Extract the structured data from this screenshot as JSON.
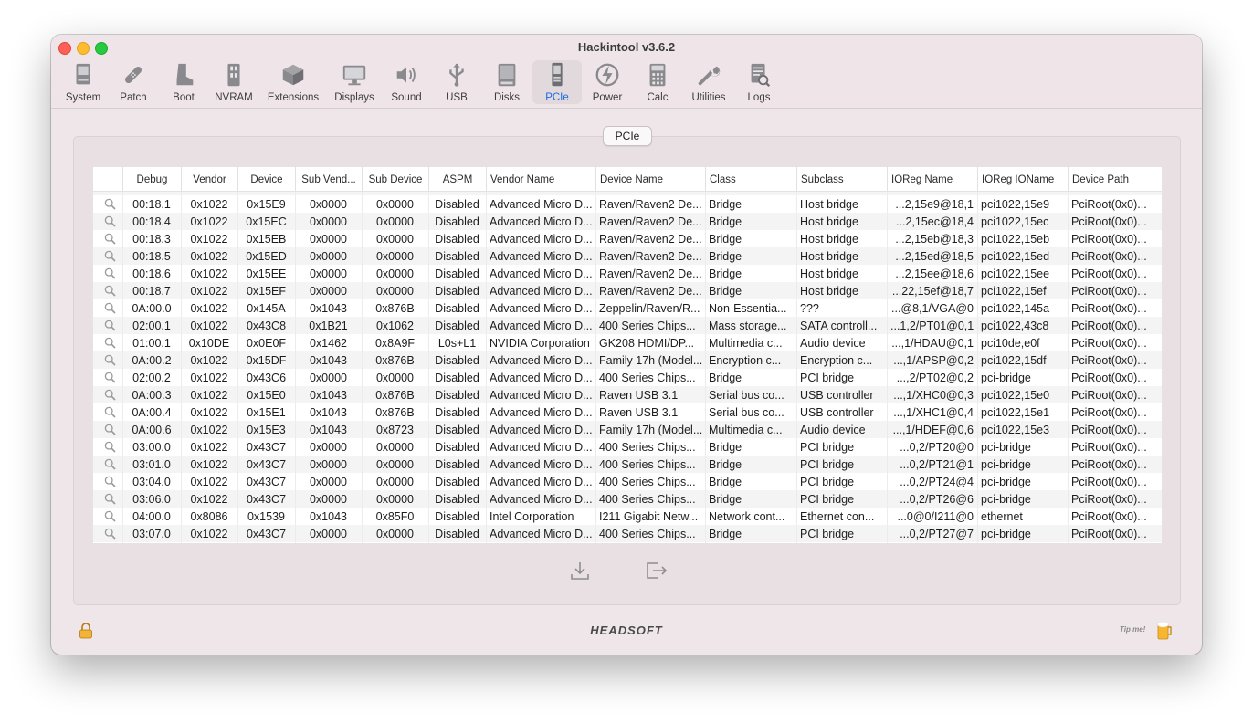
{
  "window": {
    "title": "Hackintool v3.6.2"
  },
  "toolbar": [
    {
      "label": "System",
      "icon": "system-icon"
    },
    {
      "label": "Patch",
      "icon": "patch-icon"
    },
    {
      "label": "Boot",
      "icon": "boot-icon"
    },
    {
      "label": "NVRAM",
      "icon": "nvram-icon"
    },
    {
      "label": "Extensions",
      "icon": "extensions-icon"
    },
    {
      "label": "Displays",
      "icon": "displays-icon"
    },
    {
      "label": "Sound",
      "icon": "sound-icon"
    },
    {
      "label": "USB",
      "icon": "usb-icon"
    },
    {
      "label": "Disks",
      "icon": "disks-icon"
    },
    {
      "label": "PCIe",
      "icon": "pcie-icon",
      "active": true
    },
    {
      "label": "Power",
      "icon": "power-icon"
    },
    {
      "label": "Calc",
      "icon": "calc-icon"
    },
    {
      "label": "Utilities",
      "icon": "utilities-icon"
    },
    {
      "label": "Logs",
      "icon": "logs-icon"
    }
  ],
  "segment": {
    "label": "PCIe"
  },
  "table": {
    "columns": [
      "",
      "Debug",
      "Vendor",
      "Device",
      "Sub Vend...",
      "Sub Device",
      "ASPM",
      "Vendor Name",
      "Device Name",
      "Class",
      "Subclass",
      "IOReg Name",
      "IOReg IOName",
      "Device Path"
    ],
    "partial_row_top": {
      "subclass": "Host bridge"
    },
    "rows": [
      [
        "00:18.1",
        "0x1022",
        "0x15E9",
        "0x0000",
        "0x0000",
        "Disabled",
        "Advanced Micro D...",
        "Raven/Raven2 De...",
        "Bridge",
        "Host bridge",
        "...2,15e9@18,1",
        "pci1022,15e9",
        "PciRoot(0x0)..."
      ],
      [
        "00:18.4",
        "0x1022",
        "0x15EC",
        "0x0000",
        "0x0000",
        "Disabled",
        "Advanced Micro D...",
        "Raven/Raven2 De...",
        "Bridge",
        "Host bridge",
        "...2,15ec@18,4",
        "pci1022,15ec",
        "PciRoot(0x0)..."
      ],
      [
        "00:18.3",
        "0x1022",
        "0x15EB",
        "0x0000",
        "0x0000",
        "Disabled",
        "Advanced Micro D...",
        "Raven/Raven2 De...",
        "Bridge",
        "Host bridge",
        "...2,15eb@18,3",
        "pci1022,15eb",
        "PciRoot(0x0)..."
      ],
      [
        "00:18.5",
        "0x1022",
        "0x15ED",
        "0x0000",
        "0x0000",
        "Disabled",
        "Advanced Micro D...",
        "Raven/Raven2 De...",
        "Bridge",
        "Host bridge",
        "...2,15ed@18,5",
        "pci1022,15ed",
        "PciRoot(0x0)..."
      ],
      [
        "00:18.6",
        "0x1022",
        "0x15EE",
        "0x0000",
        "0x0000",
        "Disabled",
        "Advanced Micro D...",
        "Raven/Raven2 De...",
        "Bridge",
        "Host bridge",
        "...2,15ee@18,6",
        "pci1022,15ee",
        "PciRoot(0x0)..."
      ],
      [
        "00:18.7",
        "0x1022",
        "0x15EF",
        "0x0000",
        "0x0000",
        "Disabled",
        "Advanced Micro D...",
        "Raven/Raven2 De...",
        "Bridge",
        "Host bridge",
        "...22,15ef@18,7",
        "pci1022,15ef",
        "PciRoot(0x0)..."
      ],
      [
        "0A:00.0",
        "0x1022",
        "0x145A",
        "0x1043",
        "0x876B",
        "Disabled",
        "Advanced Micro D...",
        "Zeppelin/Raven/R...",
        "Non-Essentia...",
        "???",
        "...@8,1/VGA@0",
        "pci1022,145a",
        "PciRoot(0x0)..."
      ],
      [
        "02:00.1",
        "0x1022",
        "0x43C8",
        "0x1B21",
        "0x1062",
        "Disabled",
        "Advanced Micro D...",
        "400 Series Chips...",
        "Mass storage...",
        "SATA controll...",
        "...1,2/PT01@0,1",
        "pci1022,43c8",
        "PciRoot(0x0)..."
      ],
      [
        "01:00.1",
        "0x10DE",
        "0x0E0F",
        "0x1462",
        "0x8A9F",
        "L0s+L1",
        "NVIDIA Corporation",
        "GK208 HDMI/DP...",
        "Multimedia c...",
        "Audio device",
        "...,1/HDAU@0,1",
        "pci10de,e0f",
        "PciRoot(0x0)..."
      ],
      [
        "0A:00.2",
        "0x1022",
        "0x15DF",
        "0x1043",
        "0x876B",
        "Disabled",
        "Advanced Micro D...",
        "Family 17h (Model...",
        "Encryption c...",
        "Encryption c...",
        "...,1/APSP@0,2",
        "pci1022,15df",
        "PciRoot(0x0)..."
      ],
      [
        "02:00.2",
        "0x1022",
        "0x43C6",
        "0x0000",
        "0x0000",
        "Disabled",
        "Advanced Micro D...",
        "400 Series Chips...",
        "Bridge",
        "PCI bridge",
        "...,2/PT02@0,2",
        "pci-bridge",
        "PciRoot(0x0)..."
      ],
      [
        "0A:00.3",
        "0x1022",
        "0x15E0",
        "0x1043",
        "0x876B",
        "Disabled",
        "Advanced Micro D...",
        "Raven USB 3.1",
        "Serial bus co...",
        "USB controller",
        "...,1/XHC0@0,3",
        "pci1022,15e0",
        "PciRoot(0x0)..."
      ],
      [
        "0A:00.4",
        "0x1022",
        "0x15E1",
        "0x1043",
        "0x876B",
        "Disabled",
        "Advanced Micro D...",
        "Raven USB 3.1",
        "Serial bus co...",
        "USB controller",
        "...,1/XHC1@0,4",
        "pci1022,15e1",
        "PciRoot(0x0)..."
      ],
      [
        "0A:00.6",
        "0x1022",
        "0x15E3",
        "0x1043",
        "0x8723",
        "Disabled",
        "Advanced Micro D...",
        "Family 17h (Model...",
        "Multimedia c...",
        "Audio device",
        "...,1/HDEF@0,6",
        "pci1022,15e3",
        "PciRoot(0x0)..."
      ],
      [
        "03:00.0",
        "0x1022",
        "0x43C7",
        "0x0000",
        "0x0000",
        "Disabled",
        "Advanced Micro D...",
        "400 Series Chips...",
        "Bridge",
        "PCI bridge",
        "...0,2/PT20@0",
        "pci-bridge",
        "PciRoot(0x0)..."
      ],
      [
        "03:01.0",
        "0x1022",
        "0x43C7",
        "0x0000",
        "0x0000",
        "Disabled",
        "Advanced Micro D...",
        "400 Series Chips...",
        "Bridge",
        "PCI bridge",
        "...0,2/PT21@1",
        "pci-bridge",
        "PciRoot(0x0)..."
      ],
      [
        "03:04.0",
        "0x1022",
        "0x43C7",
        "0x0000",
        "0x0000",
        "Disabled",
        "Advanced Micro D...",
        "400 Series Chips...",
        "Bridge",
        "PCI bridge",
        "...0,2/PT24@4",
        "pci-bridge",
        "PciRoot(0x0)..."
      ],
      [
        "03:06.0",
        "0x1022",
        "0x43C7",
        "0x0000",
        "0x0000",
        "Disabled",
        "Advanced Micro D...",
        "400 Series Chips...",
        "Bridge",
        "PCI bridge",
        "...0,2/PT26@6",
        "pci-bridge",
        "PciRoot(0x0)..."
      ],
      [
        "04:00.0",
        "0x8086",
        "0x1539",
        "0x1043",
        "0x85F0",
        "Disabled",
        "Intel Corporation",
        "I211 Gigabit Netw...",
        "Network cont...",
        "Ethernet con...",
        "...0@0/I211@0",
        "ethernet",
        "PciRoot(0x0)..."
      ],
      [
        "03:07.0",
        "0x1022",
        "0x43C7",
        "0x0000",
        "0x0000",
        "Disabled",
        "Advanced Micro D...",
        "400 Series Chips...",
        "Bridge",
        "PCI bridge",
        "...0,2/PT27@7",
        "pci-bridge",
        "PciRoot(0x0)..."
      ]
    ]
  },
  "footer": {
    "logo": "HEADSOFT",
    "tip": "Tip me!"
  }
}
